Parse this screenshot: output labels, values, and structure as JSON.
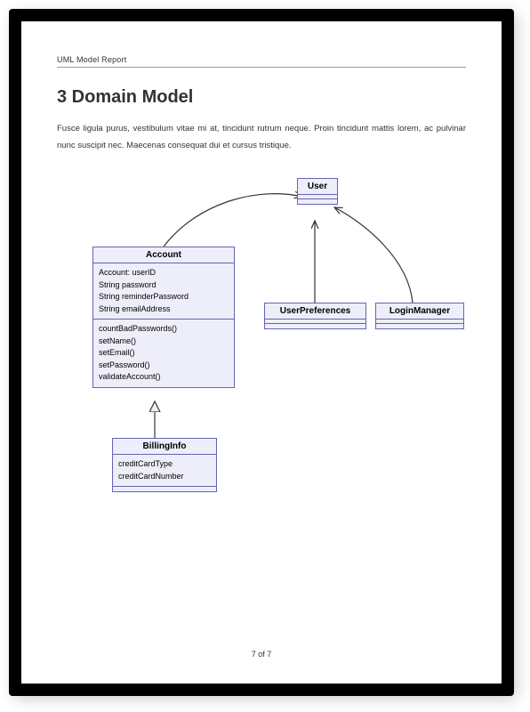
{
  "report": {
    "header": "UML Model Report",
    "section_title": "3 Domain Model",
    "body": "Fusce ligula purus, vestibulum vitae mi at, tincidunt rutrum neque.  Proin tincidunt mattis lorem, ac pulvinar nunc suscipit nec. Maecenas consequat dui et cursus tristique.",
    "footer": "7 of 7"
  },
  "classes": {
    "user": {
      "name": "User"
    },
    "account": {
      "name": "Account",
      "attributes": [
        "Account: userID",
        "String password",
        "String reminderPassword",
        "String emailAddress"
      ],
      "operations": [
        "countBadPasswords()",
        "setName()",
        "setEmail()",
        "setPassword()",
        "validateAccount()"
      ]
    },
    "userPreferences": {
      "name": "UserPreferences"
    },
    "loginManager": {
      "name": "LoginManager"
    },
    "billingInfo": {
      "name": "BillingInfo",
      "attributes": [
        "creditCardType",
        "creditCardNumber"
      ]
    }
  }
}
